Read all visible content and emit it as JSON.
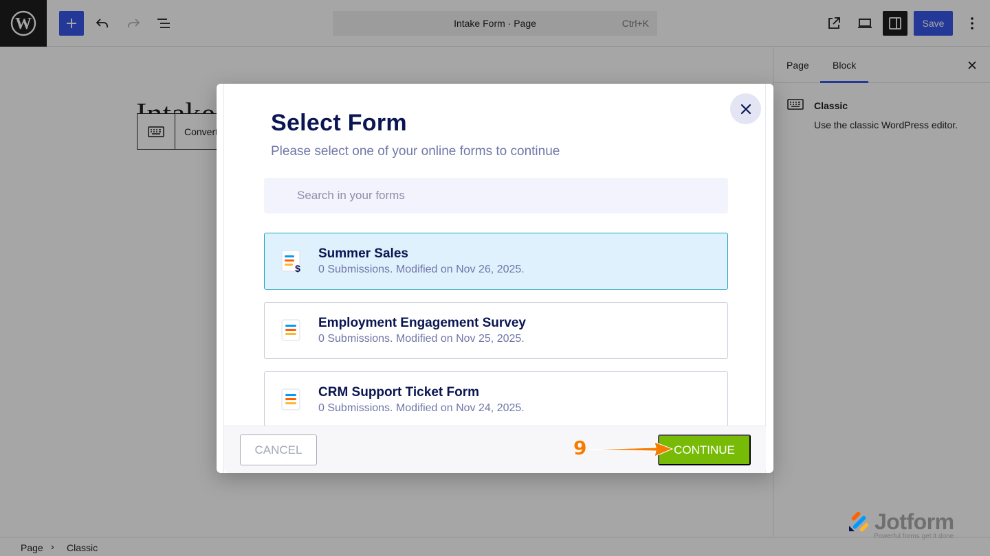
{
  "editor": {
    "document_title": "Intake Form · Page",
    "command_shortcut": "Ctrl+K",
    "save_label": "Save",
    "page_heading": "Intake",
    "block_toolbar_label": "Convert",
    "icons": {
      "logo": "wordpress-logo-icon",
      "add": "plus-icon",
      "undo": "undo-icon",
      "redo": "redo-icon",
      "list_view": "list-view-icon",
      "view": "external-view-icon",
      "preview": "laptop-preview-icon",
      "settings": "sidebar-settings-icon",
      "more": "vertical-dots-icon",
      "classic_block": "keyboard-icon"
    }
  },
  "sidebar": {
    "tabs": [
      {
        "label": "Page",
        "active": false
      },
      {
        "label": "Block",
        "active": true
      }
    ],
    "block_name": "Classic",
    "block_description": "Use the classic WordPress editor."
  },
  "breadcrumb": {
    "items": [
      "Page",
      "Classic"
    ],
    "separator": "›"
  },
  "modal": {
    "title": "Select Form",
    "subtitle": "Please select one of your online forms to continue",
    "search_placeholder": "Search in your forms",
    "forms": [
      {
        "title": "Summer Sales",
        "meta": "0 Submissions. Modified on Nov 26, 2025.",
        "selected": true,
        "icon": "payment-form-icon"
      },
      {
        "title": "Employment Engagement Survey",
        "meta": "0 Submissions. Modified on Nov 25, 2025.",
        "selected": false,
        "icon": "form-icon"
      },
      {
        "title": "CRM Support Ticket Form",
        "meta": "0 Submissions. Modified on Nov 24, 2025.",
        "selected": false,
        "icon": "form-icon"
      }
    ],
    "cancel_label": "CANCEL",
    "continue_label": "CONTINUE"
  },
  "annotation": {
    "step_number": "9"
  },
  "watermark": {
    "brand": "Jotform",
    "tagline": "Powerful forms get it done"
  },
  "colors": {
    "wp_accent": "#3858e9",
    "jotform_navy": "#0a1551",
    "selected_bg": "#dff1fd",
    "selected_border": "#18a4b8",
    "continue_green": "#78bb07",
    "annotation_orange": "#f57c00"
  }
}
